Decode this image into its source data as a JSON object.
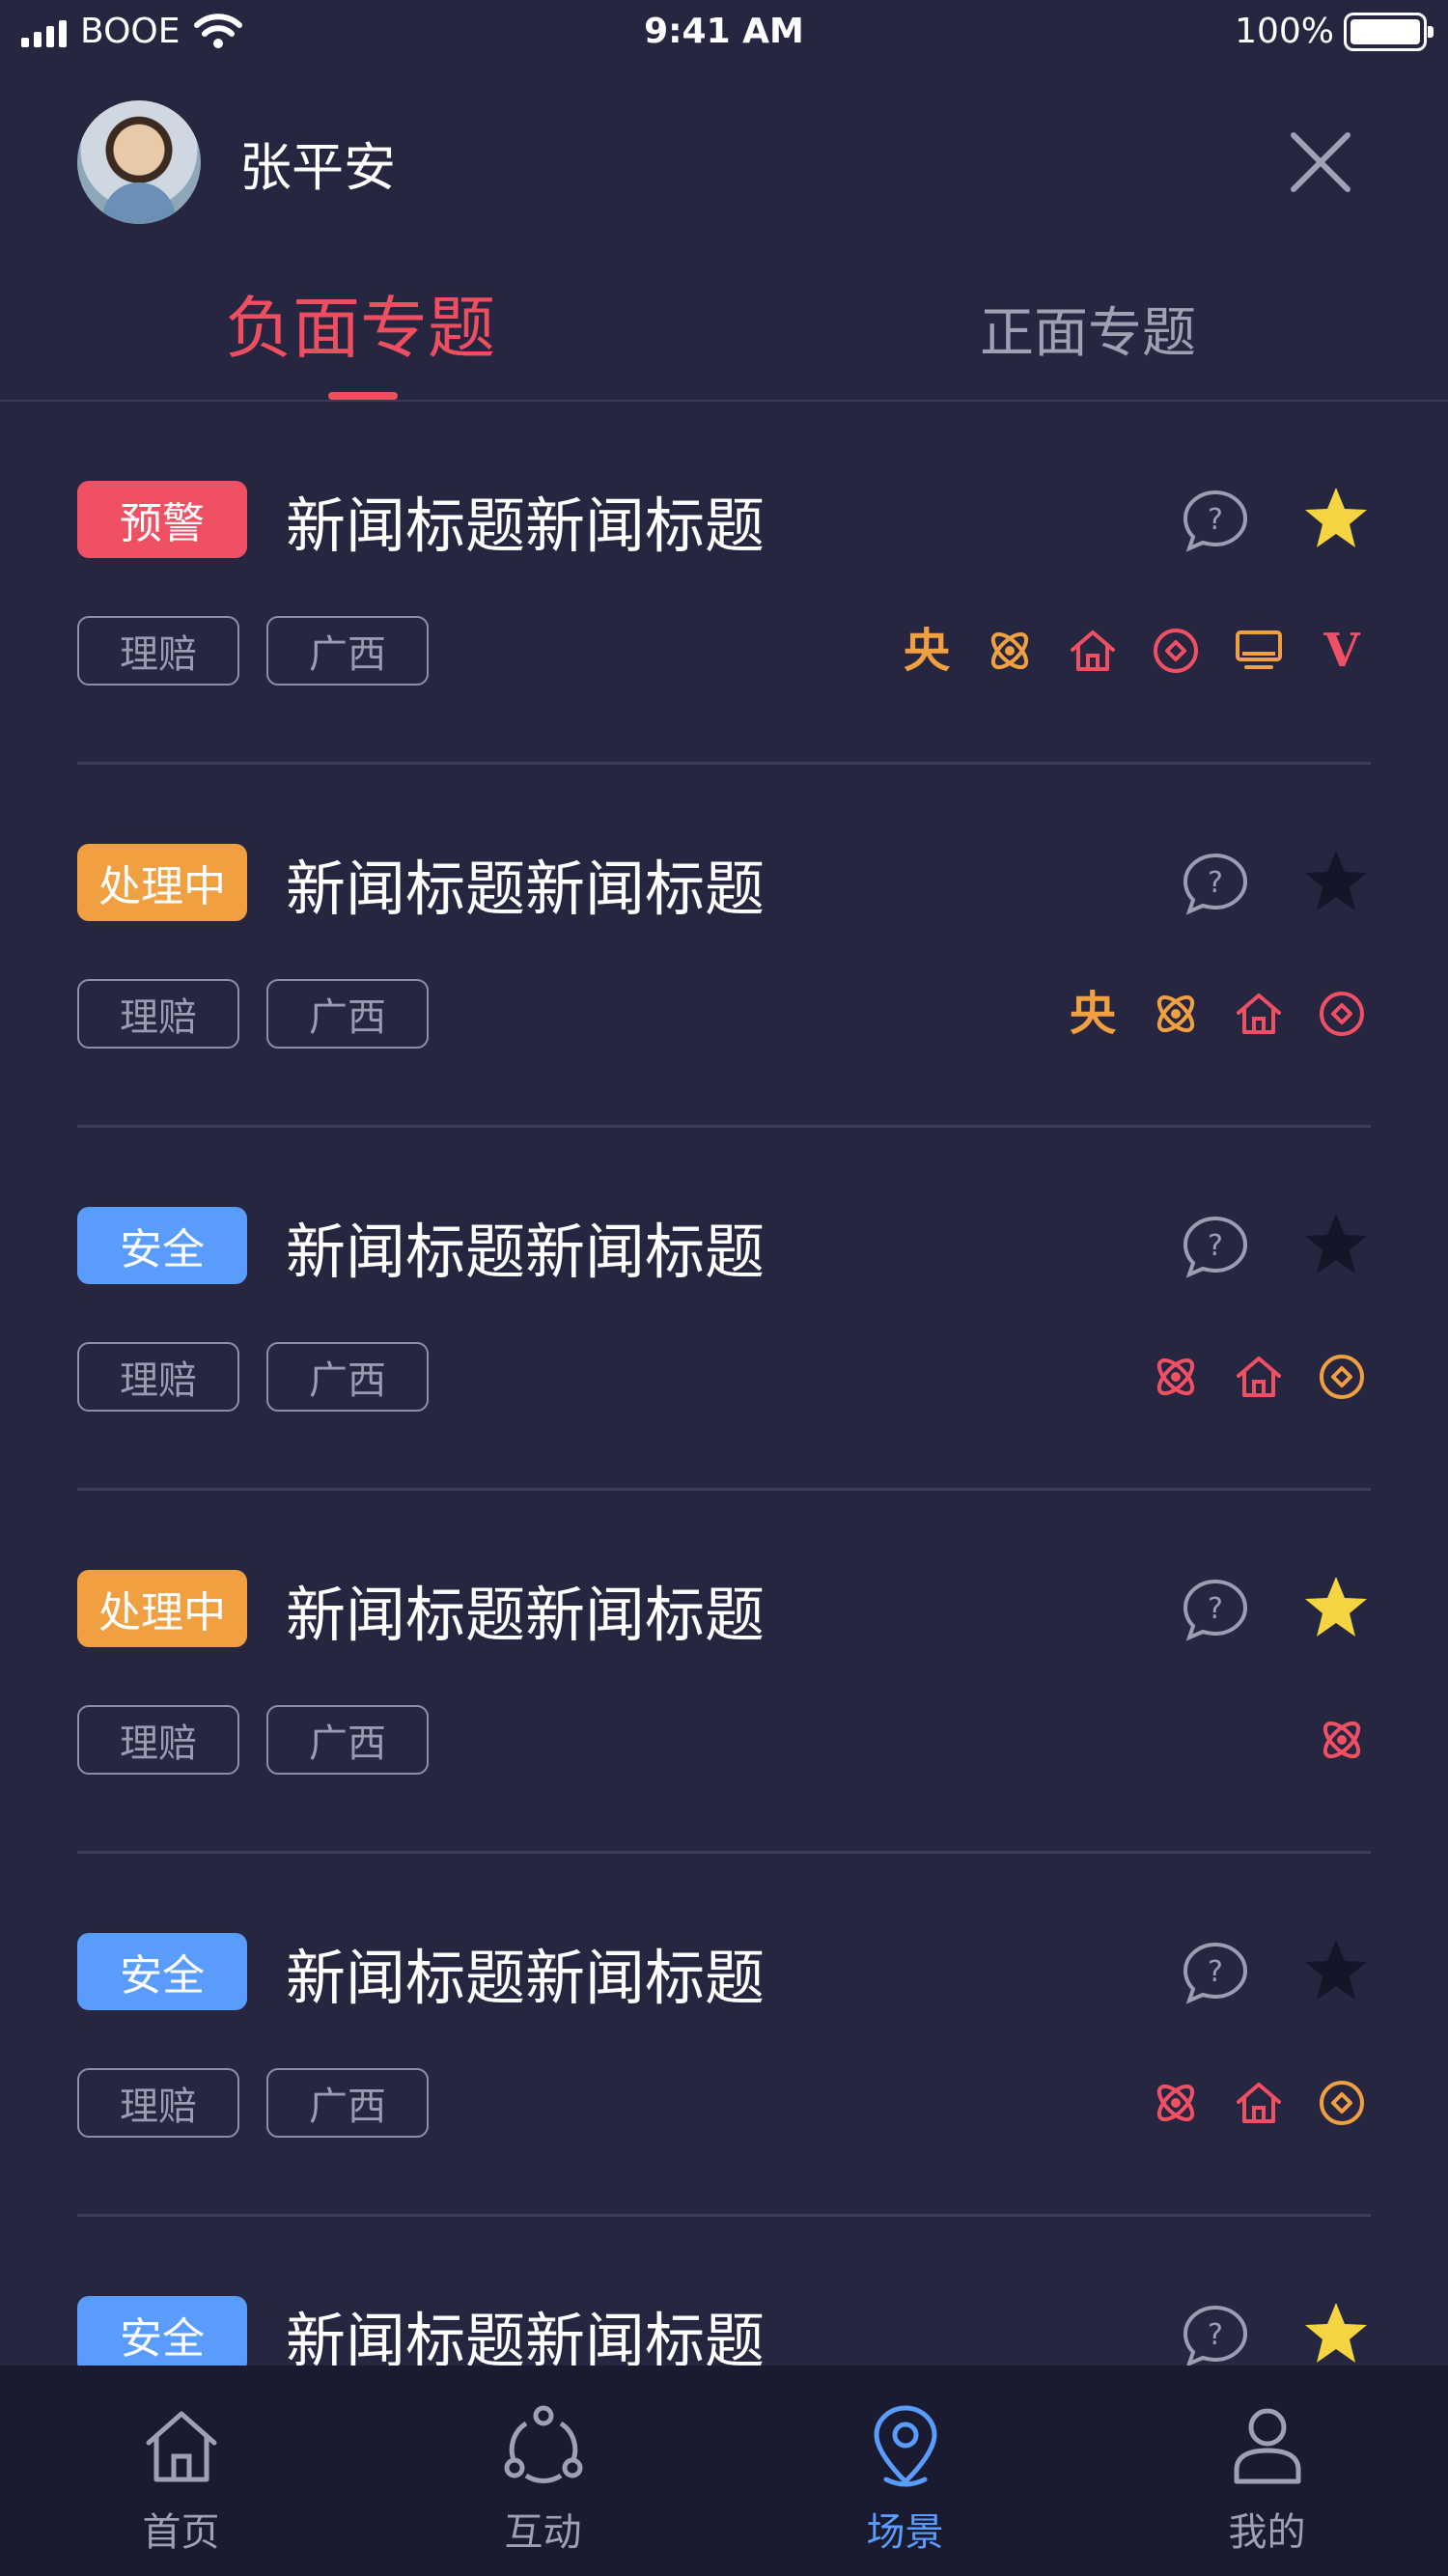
{
  "status_bar": {
    "carrier": "BOOE",
    "time": "9:41 AM",
    "battery": "100%"
  },
  "user": {
    "name": "张平安"
  },
  "tabs": [
    {
      "label": "负面专题",
      "active": true
    },
    {
      "label": "正面专题",
      "active": false
    }
  ],
  "news": [
    {
      "status": "预警",
      "status_color": "#f05064",
      "title": "新闻标题新闻标题",
      "starred": true,
      "tags": [
        "理赔",
        "广西"
      ],
      "channels": [
        "yang-icon",
        "atom-icon",
        "home-icon",
        "target-icon",
        "monitor-icon",
        "v-icon"
      ]
    },
    {
      "status": "处理中",
      "status_color": "#f0a041",
      "title": "新闻标题新闻标题",
      "starred": false,
      "tags": [
        "理赔",
        "广西"
      ],
      "channels": [
        "yang-icon",
        "atom-icon",
        "home-icon",
        "target-icon"
      ]
    },
    {
      "status": "安全",
      "status_color": "#5a9cfb",
      "title": "新闻标题新闻标题",
      "starred": false,
      "tags": [
        "理赔",
        "广西"
      ],
      "channels": [
        "atom-icon",
        "home-icon",
        "target-icon"
      ]
    },
    {
      "status": "处理中",
      "status_color": "#f0a041",
      "title": "新闻标题新闻标题",
      "starred": true,
      "tags": [
        "理赔",
        "广西"
      ],
      "channels": [
        "atom-icon"
      ]
    },
    {
      "status": "安全",
      "status_color": "#5a9cfb",
      "title": "新闻标题新闻标题",
      "starred": false,
      "tags": [
        "理赔",
        "广西"
      ],
      "channels": [
        "atom-icon",
        "home-icon",
        "target-icon"
      ]
    },
    {
      "status": "安全",
      "status_color": "#5a9cfb",
      "title": "新闻标题新闻标题",
      "starred": true,
      "tags": [],
      "channels": []
    }
  ],
  "channel_glyphs": {
    "yang-icon": "央",
    "v-icon": "V"
  },
  "colors": {
    "accent": "#ee4e5f",
    "orange": "#f0a041",
    "red": "#f05064",
    "blue": "#5a9cfb",
    "star_on": "#f5d442",
    "star_off": "#15152a"
  },
  "tabbar": [
    {
      "label": "首页",
      "icon": "home-icon",
      "active": false
    },
    {
      "label": "互动",
      "icon": "share-icon",
      "active": false
    },
    {
      "label": "场景",
      "icon": "location-pin-icon",
      "active": true
    },
    {
      "label": "我的",
      "icon": "user-icon",
      "active": false
    }
  ]
}
